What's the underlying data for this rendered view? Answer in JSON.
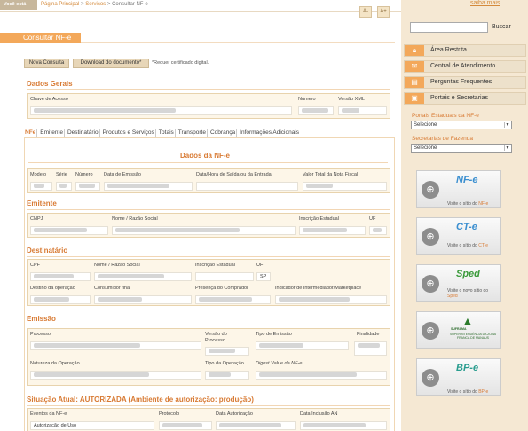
{
  "breadcrumb": {
    "voce_esta": "Você está aqui",
    "home": "Página Principal",
    "sep": ">",
    "servicos": "Serviços",
    "current": "Consultar NF-e"
  },
  "font_buttons": {
    "smaller": "A-",
    "larger": "A+"
  },
  "page_title": "Consultar NF-e",
  "actions": {
    "nova_consulta": "Nova Consulta",
    "download": "Download do documento*",
    "note": "*Requer certificado digital."
  },
  "dados_gerais": {
    "title": "Dados Gerais",
    "chave_label": "Chave de Acesso",
    "numero_label": "Número",
    "versao_label": "Versão XML"
  },
  "tabs": [
    "NFe",
    "Emitente",
    "Destinatário",
    "Produtos e Serviços",
    "Totais",
    "Transporte",
    "Cobrança",
    "Informações Adicionais"
  ],
  "dados_nfe": {
    "title": "Dados da NF-e",
    "cols": [
      "Modelo",
      "Série",
      "Número",
      "Data de Emissão",
      "Data/Hora de Saída ou da Entrada",
      "Valor Total da Nota Fiscal"
    ]
  },
  "emitente": {
    "title": "Emitente",
    "cols": [
      "CNPJ",
      "Nome / Razão Social",
      "Inscrição Estadual",
      "UF"
    ]
  },
  "destinatario": {
    "title": "Destinatário",
    "cols": [
      "CPF",
      "Nome / Razão Social",
      "Inscrição Estadual",
      "UF"
    ],
    "uf_value": "SP",
    "cols2": [
      "Destino da operação",
      "Consumidor final",
      "Presença do Comprador",
      "Indicador de Intermediador/Marketplace"
    ]
  },
  "emissao": {
    "title": "Emissão",
    "cols": [
      "Processo",
      "Versão do Processo",
      "Tipo de Emissão",
      "Finalidade"
    ],
    "cols2": [
      "Natureza da Operação",
      "Tipo da Operação",
      "Digest Value da NF-e"
    ]
  },
  "situacao": {
    "title": "Situação Atual: AUTORIZADA (Ambiente de autorização: produção)",
    "cols": [
      "Eventos da NF-e",
      "Protocolo",
      "Data Autorização",
      "Data Inclusão AN"
    ],
    "row_event": "Autorização de Uso"
  },
  "sidebar": {
    "saiba_mais": "saiba mais",
    "search_button": "Buscar",
    "menu": [
      {
        "label": "Área Restrita",
        "icon": "lock-icon"
      },
      {
        "label": "Central de Atendimento",
        "icon": "mail-icon"
      },
      {
        "label": "Perguntas Frequentes",
        "icon": "book-icon"
      },
      {
        "label": "Portais e Secretarias",
        "icon": "document-icon"
      }
    ],
    "portais_label": "Portais Estaduais da NF-e",
    "secretarias_label": "Secretarias de Fazenda",
    "select_value": "Selecione",
    "banners": [
      {
        "logo": "NF-e",
        "caption_pre": "Visite o sítio do ",
        "caption_hl": "NF-e"
      },
      {
        "logo": "CT-e",
        "caption_pre": "Visite o sítio do ",
        "caption_hl": "CT-e"
      },
      {
        "logo": "Sped",
        "caption_pre": "Visite o novo sítio do ",
        "caption_hl": "Sped"
      },
      {
        "logo": "SUFRAMA",
        "caption_pre": "SUPERINTENDÊNCIA DA ZONA FRANCA DE MANAUS",
        "caption_hl": ""
      },
      {
        "logo": "BP-e",
        "caption_pre": "Visite o sítio do ",
        "caption_hl": "BP-e"
      }
    ]
  },
  "colors": {
    "accent": "#f3a85a",
    "heading": "#d87a33",
    "panel": "#fdf6e8",
    "sidebar": "#f5e8d3"
  }
}
